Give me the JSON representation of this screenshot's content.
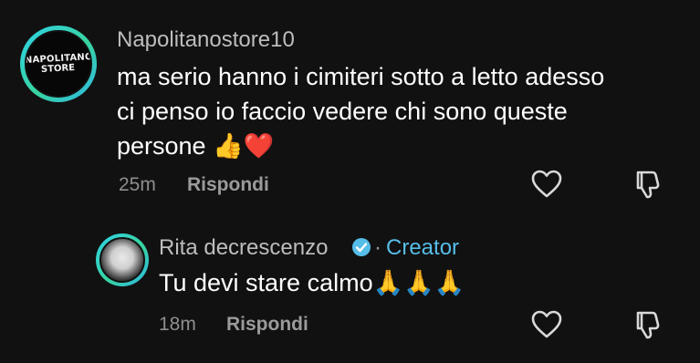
{
  "comments": [
    {
      "username": "Napolitanostore10",
      "avatar": {
        "logo_line1": "NAPOLITANO",
        "logo_line2": "STORE"
      },
      "text_lines": [
        "ma serio hanno i cimiteri sotto a letto adesso",
        "ci penso io faccio vedere chi sono queste",
        "persone 👍❤️"
      ],
      "time": "25m",
      "reply_label": "Rispondi"
    }
  ],
  "reply": {
    "username": "Rita decrescenzo",
    "verified_icon": "verified-check-icon",
    "separator": "·",
    "creator_label": "Creator",
    "text": "Tu devi stare calmo🙏🙏🙏",
    "time": "18m",
    "reply_label": "Rispondi"
  },
  "icons": {
    "like": "heart-outline-icon",
    "dislike": "thumbs-down-outline-icon"
  },
  "colors": {
    "background": "#111111",
    "creator_accent": "#56bde8",
    "avatar_ring": "#2fd3e8"
  }
}
